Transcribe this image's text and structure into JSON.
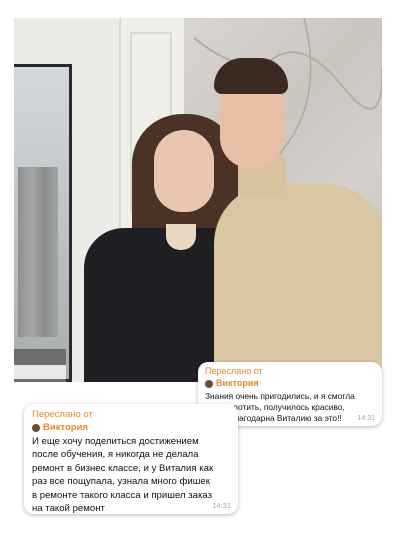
{
  "photo": {
    "description_icon": "photo"
  },
  "messages": [
    {
      "forwarded_label": "Переслано от",
      "sender": "Виктория",
      "lines": [
        "Знания очень пригодились, и я смогла",
        "его воплотить, получилось красиво,",
        "очень благодарна Виталию за это!!"
      ],
      "time": "14:31"
    },
    {
      "forwarded_label": "Переслано от",
      "sender": "Виктория",
      "lines": [
        "И еще хочу поделиться достижением",
        "после обучения, я никогда не делала",
        "ремонт в бизнес классе, и у Виталия как",
        "раз все пощупала, узнала много фишек",
        "в ремонте такого класса и пришел заказ",
        "на такой ремонт"
      ],
      "time": "14:31"
    }
  ],
  "colors": {
    "accent": "#e68a2e",
    "time": "#a8a8a8"
  }
}
